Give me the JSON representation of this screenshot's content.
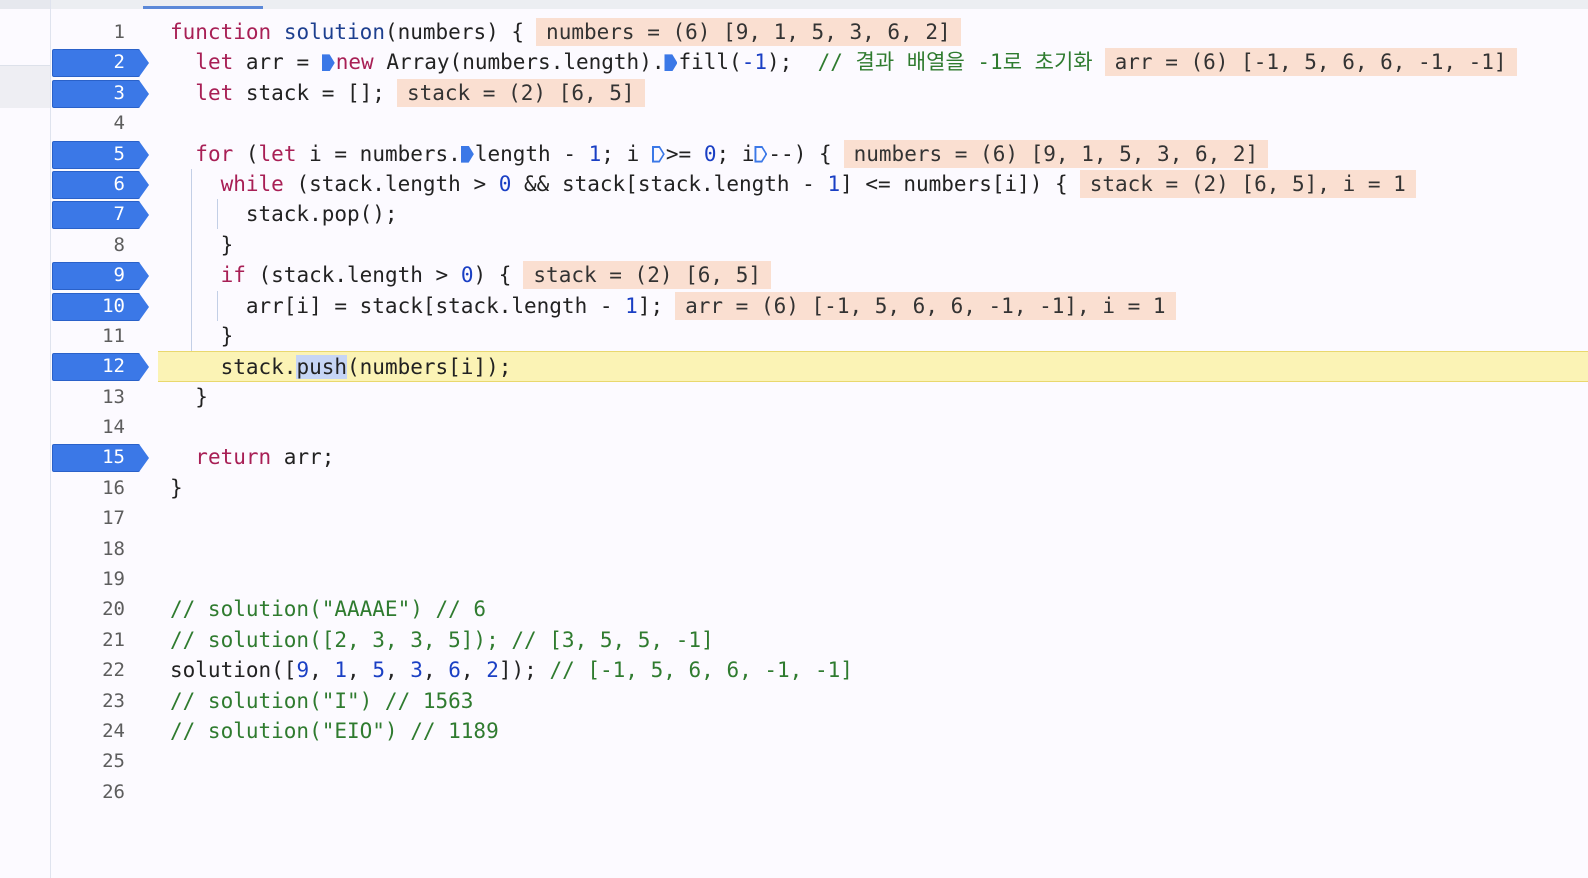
{
  "gutter": {
    "line_numbers": [
      "1",
      "2",
      "3",
      "4",
      "5",
      "6",
      "7",
      "8",
      "9",
      "10",
      "11",
      "12",
      "13",
      "14",
      "15",
      "16",
      "17",
      "18",
      "19",
      "20",
      "21",
      "22",
      "23",
      "24",
      "25",
      "26"
    ],
    "breakpoint_lines": [
      "2",
      "3",
      "5",
      "6",
      "7",
      "9",
      "10",
      "12",
      "15"
    ]
  },
  "code": {
    "l1": {
      "kw": "function",
      "fname": "solution",
      "params": "(numbers) {",
      "inline": "numbers = (6) [9, 1, 5, 3, 6, 2]"
    },
    "l2": {
      "kw": "let",
      "a": " arr = ",
      "new": "new",
      "b": " Array(numbers.length).",
      "c": "fill(",
      "n": "-1",
      "d": ");",
      "comment": "// 결과 배열을 -1로 초기화",
      "inline": "arr = (6) [-1, 5, 6, 6, -1, -1]"
    },
    "l3": {
      "kw": "let",
      "a": " stack = [];",
      "inline": "stack = (2) [6, 5]"
    },
    "l5": {
      "kw": "for",
      "a": " (",
      "kw2": "let",
      "b": " i = numbers.",
      "c": "length - ",
      "n1": "1",
      "d": "; i ",
      "e": ">= ",
      "n2": "0",
      "f": "; i",
      "g": "--) {",
      "inline": "numbers = (6) [9, 1, 5, 3, 6, 2]"
    },
    "l6": {
      "kw": "while",
      "a": " (stack.length > ",
      "n1": "0",
      "b": " && stack[stack.length - ",
      "n2": "1",
      "c": "] <= numbers[i]) {",
      "inline": "stack = (2) [6, 5], i = 1"
    },
    "l7": {
      "text": "stack.pop();"
    },
    "l8": {
      "text": "}"
    },
    "l9": {
      "kw": "if",
      "a": " (stack.length > ",
      "n": "0",
      "b": ") {",
      "inline": "stack = (2) [6, 5]"
    },
    "l10": {
      "a": "arr[i] = stack[stack.length - ",
      "n": "1",
      "b": "];",
      "inline": "arr = (6) [-1, 5, 6, 6, -1, -1], i = 1"
    },
    "l11": {
      "text": "}"
    },
    "l12": {
      "a": "stack.",
      "sel": "push",
      "b": "(numbers[i]);"
    },
    "l13": {
      "text": "}"
    },
    "l15": {
      "kw": "return",
      "a": " arr;"
    },
    "l16": {
      "text": "}"
    },
    "l20": {
      "comment": "// solution(\"AAAAE\") // 6"
    },
    "l21": {
      "comment": "// solution([2, 3, 3, 5]); // [3, 5, 5, -1]"
    },
    "l22": {
      "a": "solution([",
      "n1": "9",
      "s1": ", ",
      "n2": "1",
      "s2": ", ",
      "n3": "5",
      "s3": ", ",
      "n4": "3",
      "s4": ", ",
      "n5": "6",
      "s5": ", ",
      "n6": "2",
      "b": "]); ",
      "comment": "// [-1, 5, 6, 6, -1, -1]"
    },
    "l23": {
      "comment": "// solution(\"I\") // 1563"
    },
    "l24": {
      "comment": "// solution(\"EIO\") // 1189"
    }
  }
}
